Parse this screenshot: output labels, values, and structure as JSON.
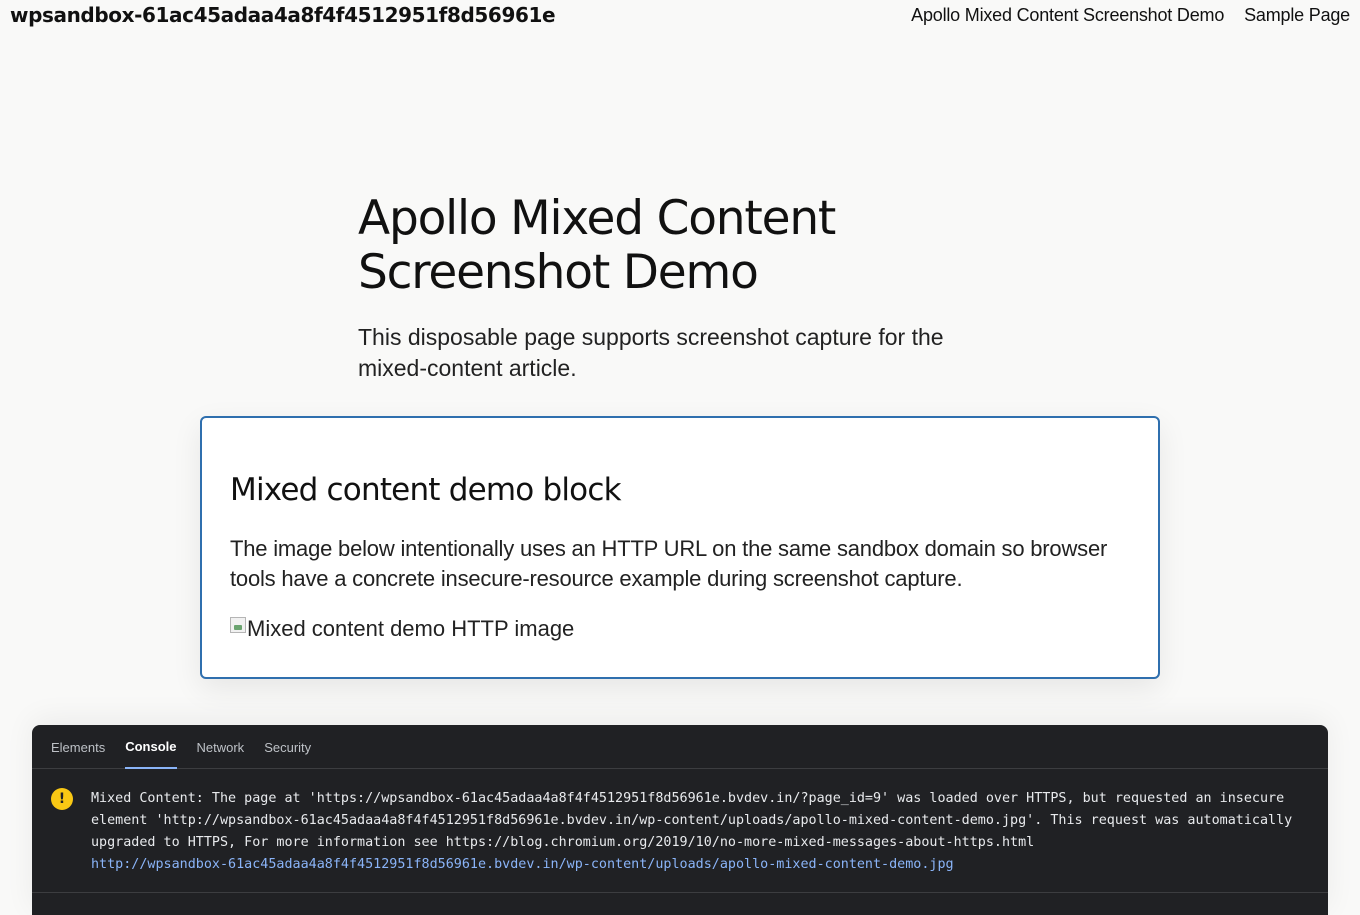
{
  "header": {
    "site_title": "wpsandbox-61ac45adaa4a8f4f4512951f8d56961e",
    "nav": [
      {
        "label": "Apollo Mixed Content Screenshot Demo"
      },
      {
        "label": "Sample Page"
      }
    ]
  },
  "hero": {
    "title": "Apollo Mixed Content Screenshot Demo",
    "subtitle": "This disposable page supports screenshot capture for the mixed-content article."
  },
  "card": {
    "heading": "Mixed content demo block",
    "body": "The image below intentionally uses an HTTP URL on the same sandbox domain so browser tools have a concrete insecure-resource example during screenshot capture.",
    "image_alt": "Mixed content demo HTTP image"
  },
  "devtools": {
    "tabs": [
      {
        "label": "Elements"
      },
      {
        "label": "Console"
      },
      {
        "label": "Network"
      },
      {
        "label": "Security"
      }
    ],
    "active_tab": "Console",
    "console": {
      "warning_icon": "!",
      "message": "Mixed Content: The page at 'https://wpsandbox-61ac45adaa4a8f4f4512951f8d56961e.bvdev.in/?page_id=9' was loaded over HTTPS, but requested an insecure element 'http://wpsandbox-61ac45adaa4a8f4f4512951f8d56961e.bvdev.in/wp-content/uploads/apollo-mixed-content-demo.jpg'. This request was automatically upgraded to HTTPS, For more information see https://blog.chromium.org/2019/10/no-more-mixed-messages-about-https.html",
      "link": "http://wpsandbox-61ac45adaa4a8f4f4512951f8d56961e.bvdev.in/wp-content/uploads/apollo-mixed-content-demo.jpg"
    }
  },
  "colors": {
    "page_bg": "#f9f9f8",
    "card_border": "#2f6fae",
    "devtools_bg": "#202124",
    "warning": "#f9c814",
    "link": "#8ab4f8"
  }
}
